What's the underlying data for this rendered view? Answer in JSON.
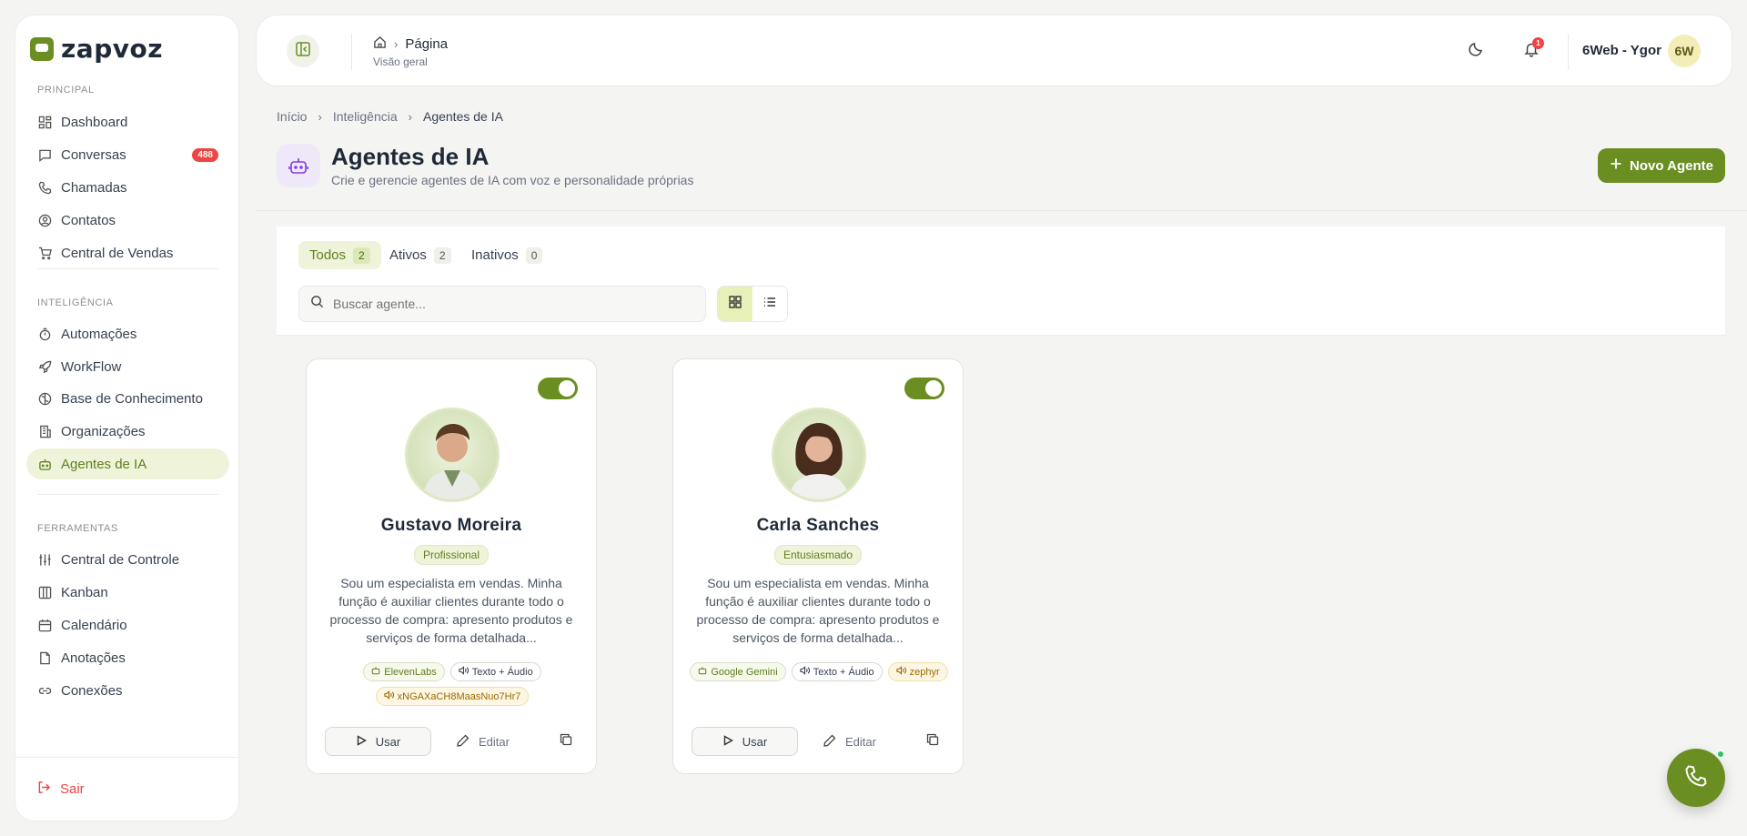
{
  "brand": {
    "name": "zapvoz",
    "accent": "#6b8e23"
  },
  "sidebar": {
    "sections": [
      {
        "label": "PRINCIPAL"
      },
      {
        "label": "INTELIGÊNCIA"
      },
      {
        "label": "FERRAMENTAS"
      }
    ],
    "items": [
      {
        "label": "Dashboard",
        "icon": "dashboard-icon"
      },
      {
        "label": "Conversas",
        "icon": "chat-icon",
        "badge": "488"
      },
      {
        "label": "Chamadas",
        "icon": "phone-icon"
      },
      {
        "label": "Contatos",
        "icon": "contact-icon"
      },
      {
        "label": "Central de Vendas",
        "icon": "cart-icon"
      },
      {
        "label": "Automações",
        "icon": "timer-icon"
      },
      {
        "label": "WorkFlow",
        "icon": "rocket-icon"
      },
      {
        "label": "Base de Conhecimento",
        "icon": "brain-icon"
      },
      {
        "label": "Organizações",
        "icon": "building-icon"
      },
      {
        "label": "Agentes de IA",
        "icon": "bot-icon",
        "active": true
      },
      {
        "label": "Central de Controle",
        "icon": "sliders-icon"
      },
      {
        "label": "Kanban",
        "icon": "kanban-icon"
      },
      {
        "label": "Calendário",
        "icon": "calendar-icon"
      },
      {
        "label": "Anotações",
        "icon": "note-icon"
      },
      {
        "label": "Conexões",
        "icon": "link-icon"
      }
    ],
    "logout_label": "Sair"
  },
  "header": {
    "page_label": "Página",
    "page_sub": "Visão geral",
    "notifications_count": "1",
    "user_name": "6Web - Ygor",
    "user_initials": "6W"
  },
  "breadcrumb": [
    "Início",
    "Inteligência",
    "Agentes de IA"
  ],
  "page": {
    "title": "Agentes de IA",
    "subtitle": "Crie e gerencie agentes de IA com voz e personalidade próprias",
    "new_button": "Novo Agente"
  },
  "filters": {
    "tabs": [
      {
        "label": "Todos",
        "count": "2",
        "active": true
      },
      {
        "label": "Ativos",
        "count": "2"
      },
      {
        "label": "Inativos",
        "count": "0"
      }
    ],
    "search_placeholder": "Buscar agente...",
    "view": "grid"
  },
  "agents": [
    {
      "name": "Gustavo Moreira",
      "persona": "Profissional",
      "enabled": true,
      "description": "Sou um especialista em vendas. Minha função é auxiliar clientes durante todo o processo de compra: apresento produtos e serviços de forma detalhada...",
      "provider": "ElevenLabs",
      "mode": "Texto + Áudio",
      "voice": "xNGAXaCH8MaasNuo7Hr7",
      "use_label": "Usar",
      "edit_label": "Editar"
    },
    {
      "name": "Carla Sanches",
      "persona": "Entusiasmado",
      "enabled": true,
      "description": "Sou um especialista em vendas. Minha função é auxiliar clientes durante todo o processo de compra: apresento produtos e serviços de forma detalhada...",
      "provider": "Google Gemini",
      "mode": "Texto + Áudio",
      "voice": "zephyr",
      "use_label": "Usar",
      "edit_label": "Editar"
    }
  ]
}
